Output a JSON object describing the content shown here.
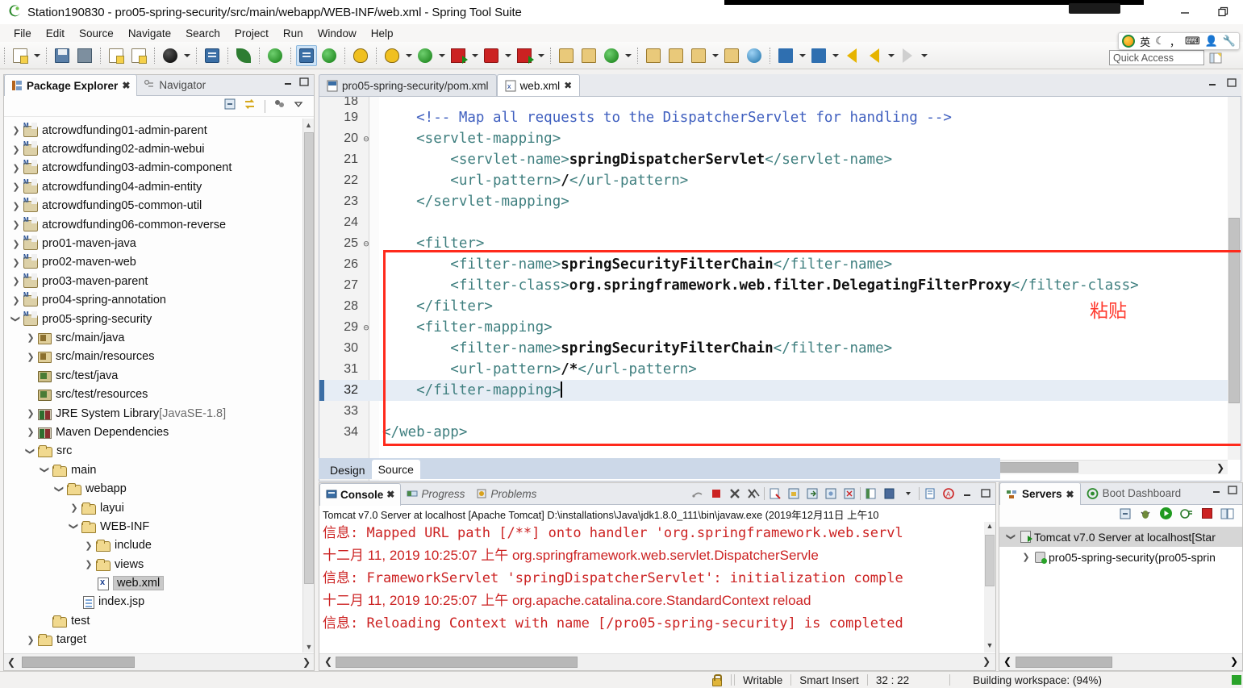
{
  "window": {
    "title": "Station190830 - pro05-spring-security/src/main/webapp/WEB-INF/web.xml - Spring Tool Suite",
    "app_icon": "sts-icon",
    "minimize_label": "—",
    "restore_label": "❐"
  },
  "menubar": {
    "items": [
      "File",
      "Edit",
      "Source",
      "Navigate",
      "Search",
      "Project",
      "Run",
      "Window",
      "Help"
    ]
  },
  "quick_access": {
    "placeholder": "Quick Access",
    "value": "Quick Access"
  },
  "ime_bar": {
    "mode": "英",
    "items": [
      "ime-logo",
      "英",
      "moon-icon",
      "punct-icon",
      "keyboard-icon",
      "user-icon",
      "wrench-icon"
    ]
  },
  "toolbar": {
    "groups": [
      {
        "buttons": [
          {
            "name": "new-wizard-button",
            "icon": "new-doc-icon",
            "dropdown": true
          },
          {
            "name": "save-button",
            "icon": "save-icon",
            "dropdown": false
          },
          {
            "name": "save-all-button",
            "icon": "save-all-icon",
            "dropdown": false
          }
        ]
      },
      {
        "buttons": [
          {
            "name": "print-button",
            "icon": "print-icon",
            "dropdown": false
          },
          {
            "name": "export-button",
            "icon": "export-icon",
            "dropdown": false
          }
        ]
      },
      {
        "buttons": [
          {
            "name": "new-java-class-button",
            "icon": "java-class-icon",
            "dropdown": true
          }
        ]
      },
      {
        "buttons": [
          {
            "name": "open-type-button",
            "icon": "open-type-icon",
            "dropdown": false
          }
        ]
      },
      {
        "buttons": [
          {
            "name": "search-button",
            "icon": "search-icon",
            "dropdown": false
          }
        ]
      },
      {
        "buttons": [
          {
            "name": "spring-button",
            "icon": "spring-leaf-icon",
            "dropdown": false
          }
        ]
      },
      {
        "buttons": [
          {
            "name": "toggle-markoccurrences-button",
            "icon": "mark-occurrences-icon",
            "dropdown": false,
            "active": true
          },
          {
            "name": "spring-boot-button",
            "icon": "spring-boot-icon",
            "dropdown": false
          }
        ]
      },
      {
        "buttons": [
          {
            "name": "skip-breakpoints-button",
            "icon": "skip-breakpoints-icon",
            "dropdown": false
          }
        ]
      },
      {
        "buttons": [
          {
            "name": "debug-button",
            "icon": "debug-bug-icon",
            "dropdown": true
          },
          {
            "name": "run-button",
            "icon": "run-play-icon",
            "dropdown": true
          },
          {
            "name": "run-external-tools-button",
            "icon": "external-tools-icon",
            "dropdown": true
          },
          {
            "name": "terminate-button",
            "icon": "terminate-stop-icon",
            "dropdown": true
          },
          {
            "name": "run-last-button",
            "icon": "run-last-icon",
            "dropdown": true
          }
        ]
      },
      {
        "buttons": [
          {
            "name": "new-package-button",
            "icon": "new-package-icon",
            "dropdown": false
          },
          {
            "name": "new-class-button",
            "icon": "new-class-icon",
            "dropdown": false
          },
          {
            "name": "new-git-repo-button",
            "icon": "new-git-icon",
            "dropdown": true
          }
        ]
      },
      {
        "buttons": [
          {
            "name": "open-perspective-button",
            "icon": "open-perspective-icon",
            "dropdown": false
          },
          {
            "name": "open-folder-button",
            "icon": "open-folder-icon",
            "dropdown": false
          },
          {
            "name": "edit-button",
            "icon": "pencil-icon",
            "dropdown": true
          },
          {
            "name": "open-resource-button",
            "icon": "open-resource-icon",
            "dropdown": false
          },
          {
            "name": "web-browser-button",
            "icon": "globe-icon",
            "dropdown": false
          }
        ]
      },
      {
        "buttons": [
          {
            "name": "next-annotation-button",
            "icon": "next-annotation-icon",
            "dropdown": true
          },
          {
            "name": "previous-annotation-button",
            "icon": "previous-annotation-icon",
            "dropdown": true
          },
          {
            "name": "back-button",
            "icon": "back-arrow-icon",
            "dropdown": false
          },
          {
            "name": "backward-history-button",
            "icon": "backward-arrow-icon",
            "dropdown": true
          },
          {
            "name": "forward-history-button",
            "icon": "forward-arrow-icon",
            "dropdown": true
          }
        ]
      }
    ]
  },
  "package_explorer": {
    "tabs": [
      {
        "label": "Package Explorer",
        "icon": "package-explorer-icon",
        "active": true,
        "closeable": true
      },
      {
        "label": "Navigator",
        "icon": "navigator-icon",
        "active": false,
        "closeable": false
      }
    ],
    "view_buttons": [
      "collapse-all-icon",
      "link-with-editor-icon",
      "view-menu-icon",
      "view-dropdown-icon"
    ],
    "minimize_label": "–",
    "maximize_label": "□",
    "tree": [
      {
        "indent": 0,
        "twisty": "right",
        "icon": "maven-project-icon",
        "label": "atcrowdfunding01-admin-parent"
      },
      {
        "indent": 0,
        "twisty": "right",
        "icon": "maven-project-warn-icon",
        "label": "atcrowdfunding02-admin-webui"
      },
      {
        "indent": 0,
        "twisty": "right",
        "icon": "maven-project-icon",
        "label": "atcrowdfunding03-admin-component"
      },
      {
        "indent": 0,
        "twisty": "right",
        "icon": "maven-project-icon",
        "label": "atcrowdfunding04-admin-entity"
      },
      {
        "indent": 0,
        "twisty": "right",
        "icon": "maven-project-icon",
        "label": "atcrowdfunding05-common-util"
      },
      {
        "indent": 0,
        "twisty": "right",
        "icon": "maven-project-icon",
        "label": "atcrowdfunding06-common-reverse"
      },
      {
        "indent": 0,
        "twisty": "right",
        "icon": "maven-project-icon",
        "label": "pro01-maven-java"
      },
      {
        "indent": 0,
        "twisty": "right",
        "icon": "maven-project-icon",
        "label": "pro02-maven-web"
      },
      {
        "indent": 0,
        "twisty": "right",
        "icon": "maven-project-icon",
        "label": "pro03-maven-parent"
      },
      {
        "indent": 0,
        "twisty": "right",
        "icon": "maven-project-icon",
        "label": "pro04-spring-annotation"
      },
      {
        "indent": 0,
        "twisty": "down",
        "icon": "maven-project-icon",
        "label": "pro05-spring-security"
      },
      {
        "indent": 1,
        "twisty": "right",
        "icon": "source-folder-icon",
        "label": "src/main/java"
      },
      {
        "indent": 1,
        "twisty": "right",
        "icon": "source-folder-icon",
        "label": "src/main/resources"
      },
      {
        "indent": 1,
        "twisty": "none",
        "icon": "test-source-folder-icon",
        "label": "src/test/java"
      },
      {
        "indent": 1,
        "twisty": "none",
        "icon": "test-source-folder-icon",
        "label": "src/test/resources"
      },
      {
        "indent": 1,
        "twisty": "right",
        "icon": "jre-library-icon",
        "label": "JRE System Library",
        "suffix": "[JavaSE-1.8]"
      },
      {
        "indent": 1,
        "twisty": "right",
        "icon": "maven-library-icon",
        "label": "Maven Dependencies"
      },
      {
        "indent": 1,
        "twisty": "down",
        "icon": "folder-icon",
        "label": "src"
      },
      {
        "indent": 2,
        "twisty": "down",
        "icon": "folder-icon",
        "label": "main"
      },
      {
        "indent": 3,
        "twisty": "down",
        "icon": "folder-icon",
        "label": "webapp"
      },
      {
        "indent": 4,
        "twisty": "right",
        "icon": "folder-icon",
        "label": "layui"
      },
      {
        "indent": 4,
        "twisty": "down",
        "icon": "folder-icon",
        "label": "WEB-INF"
      },
      {
        "indent": 5,
        "twisty": "right",
        "icon": "folder-icon",
        "label": "include"
      },
      {
        "indent": 5,
        "twisty": "right",
        "icon": "folder-icon",
        "label": "views"
      },
      {
        "indent": 5,
        "twisty": "none",
        "icon": "xml-file-icon",
        "label": "web.xml",
        "selected": true
      },
      {
        "indent": 4,
        "twisty": "none",
        "icon": "jsp-file-icon",
        "label": "index.jsp"
      },
      {
        "indent": 2,
        "twisty": "none",
        "icon": "folder-icon",
        "label": "test"
      },
      {
        "indent": 1,
        "twisty": "right",
        "icon": "folder-icon",
        "label": "target"
      }
    ]
  },
  "editor": {
    "tabs": [
      {
        "label": "pro05-spring-security/pom.xml",
        "icon": "pom-file-icon",
        "active": false,
        "closeable": false
      },
      {
        "label": "web.xml",
        "icon": "xml-file-icon",
        "active": true,
        "closeable": true
      }
    ],
    "minimize_label": "–",
    "maximize_label": "□",
    "annotation": {
      "text": "粘贴",
      "color": "#ff3b2f"
    },
    "bottom_tabs": [
      {
        "label": "Design",
        "active": false
      },
      {
        "label": "Source",
        "active": true
      }
    ],
    "lines": [
      {
        "num": "18",
        "fold": "",
        "partial": true,
        "segments": []
      },
      {
        "num": "19",
        "fold": "",
        "segments": [
          {
            "cls": "cmt",
            "text": "    <!-- Map all requests to the DispatcherServlet for handling -->"
          }
        ]
      },
      {
        "num": "20",
        "fold": "⊖",
        "segments": [
          {
            "cls": "tag",
            "text": "    <servlet-mapping>"
          }
        ]
      },
      {
        "num": "21",
        "fold": "",
        "segments": [
          {
            "cls": "tag",
            "text": "        <servlet-name>"
          },
          {
            "cls": "val",
            "text": "springDispatcherServlet"
          },
          {
            "cls": "tag",
            "text": "</servlet-name>"
          }
        ]
      },
      {
        "num": "22",
        "fold": "",
        "segments": [
          {
            "cls": "tag",
            "text": "        <url-pattern>"
          },
          {
            "cls": "val",
            "text": "/"
          },
          {
            "cls": "tag",
            "text": "</url-pattern>"
          }
        ]
      },
      {
        "num": "23",
        "fold": "",
        "segments": [
          {
            "cls": "tag",
            "text": "    </servlet-mapping>"
          }
        ]
      },
      {
        "num": "24",
        "fold": "",
        "segments": []
      },
      {
        "num": "25",
        "fold": "⊖",
        "segments": [
          {
            "cls": "tag",
            "text": "    <filter>"
          }
        ]
      },
      {
        "num": "26",
        "fold": "",
        "segments": [
          {
            "cls": "tag",
            "text": "        <filter-name>"
          },
          {
            "cls": "val",
            "text": "springSecurityFilterChain"
          },
          {
            "cls": "tag",
            "text": "</filter-name>"
          }
        ]
      },
      {
        "num": "27",
        "fold": "",
        "segments": [
          {
            "cls": "tag",
            "text": "        <filter-class>"
          },
          {
            "cls": "val",
            "text": "org.springframework.web.filter.DelegatingFilterProxy"
          },
          {
            "cls": "tag",
            "text": "</filter-class>"
          }
        ]
      },
      {
        "num": "28",
        "fold": "",
        "segments": [
          {
            "cls": "tag",
            "text": "    </filter>"
          }
        ]
      },
      {
        "num": "29",
        "fold": "⊖",
        "segments": [
          {
            "cls": "tag",
            "text": "    <filter-mapping>"
          }
        ]
      },
      {
        "num": "30",
        "fold": "",
        "segments": [
          {
            "cls": "tag",
            "text": "        <filter-name>"
          },
          {
            "cls": "val",
            "text": "springSecurityFilterChain"
          },
          {
            "cls": "tag",
            "text": "</filter-name>"
          }
        ]
      },
      {
        "num": "31",
        "fold": "",
        "segments": [
          {
            "cls": "tag",
            "text": "        <url-pattern>"
          },
          {
            "cls": "val",
            "text": "/*"
          },
          {
            "cls": "tag",
            "text": "</url-pattern>"
          }
        ]
      },
      {
        "num": "32",
        "fold": "",
        "current": true,
        "caret": true,
        "segments": [
          {
            "cls": "tag",
            "text": "    </filter-mapping>"
          }
        ]
      },
      {
        "num": "33",
        "fold": "",
        "segments": []
      },
      {
        "num": "34",
        "fold": "",
        "segments": [
          {
            "cls": "tag",
            "text": "</web-app>"
          }
        ]
      }
    ]
  },
  "console": {
    "tabs": [
      {
        "label": "Console",
        "icon": "console-icon",
        "active": true,
        "closeable": true
      },
      {
        "label": "Progress",
        "icon": "progress-icon",
        "active": false,
        "closeable": false
      },
      {
        "label": "Problems",
        "icon": "problems-icon",
        "active": false,
        "closeable": false
      }
    ],
    "toolbar_icons": [
      "terminate-gray-icon",
      "terminate-red-icon",
      "remove-launch-icon",
      "remove-all-launches-icon",
      "clear-console-icon",
      "scroll-lock-icon",
      "show-console-on-output-icon",
      "pin-console-icon",
      "display-selected-console-icon",
      "open-console-icon",
      "new-console-view-icon",
      "word-wrap-icon",
      "console-link-icon"
    ],
    "minimize_label": "–",
    "maximize_label": "□",
    "process_header": "Tomcat v7.0 Server at localhost [Apache Tomcat] D:\\installations\\Java\\jdk1.8.0_111\\bin\\javaw.exe (2019年12月11日 上午10",
    "lines": [
      {
        "type": "info",
        "text": "信息: Mapped URL path [/**] onto handler 'org.springframework.web.servl"
      },
      {
        "type": "timestamp",
        "text": "十二月 11, 2019 10:25:07 上午 org.springframework.web.servlet.DispatcherServle"
      },
      {
        "type": "info",
        "text": "信息: FrameworkServlet 'springDispatcherServlet': initialization comple"
      },
      {
        "type": "timestamp",
        "text": "十二月 11, 2019 10:25:07 上午 org.apache.catalina.core.StandardContext reload"
      },
      {
        "type": "info",
        "text": "信息: Reloading Context with name [/pro05-spring-security] is completed"
      }
    ]
  },
  "servers": {
    "tabs": [
      {
        "label": "Servers",
        "icon": "servers-icon",
        "active": true,
        "closeable": true
      },
      {
        "label": "Boot Dashboard",
        "icon": "boot-dashboard-icon",
        "active": false,
        "closeable": false
      }
    ],
    "toolbar_icons": [
      "collapse-all-icon",
      "debug-server-icon",
      "start-server-icon",
      "profile-server-icon",
      "stop-server-icon",
      "publish-icon"
    ],
    "minimize_label": "–",
    "maximize_label": "□",
    "rows": [
      {
        "indent": 0,
        "twisty": "down",
        "icon": "server-icon",
        "label": "Tomcat v7.0 Server at localhost",
        "suffix": "[Star",
        "selected": true
      },
      {
        "indent": 1,
        "twisty": "right",
        "icon": "module-icon",
        "label": "pro05-spring-security(pro05-sprin",
        "suffix": ""
      }
    ]
  },
  "statusbar": {
    "writable": "Writable",
    "insert_mode": "Smart Insert",
    "position": "32 : 22",
    "progress": "Building workspace: (94%)",
    "lock_icon": "writable-lock-icon"
  }
}
